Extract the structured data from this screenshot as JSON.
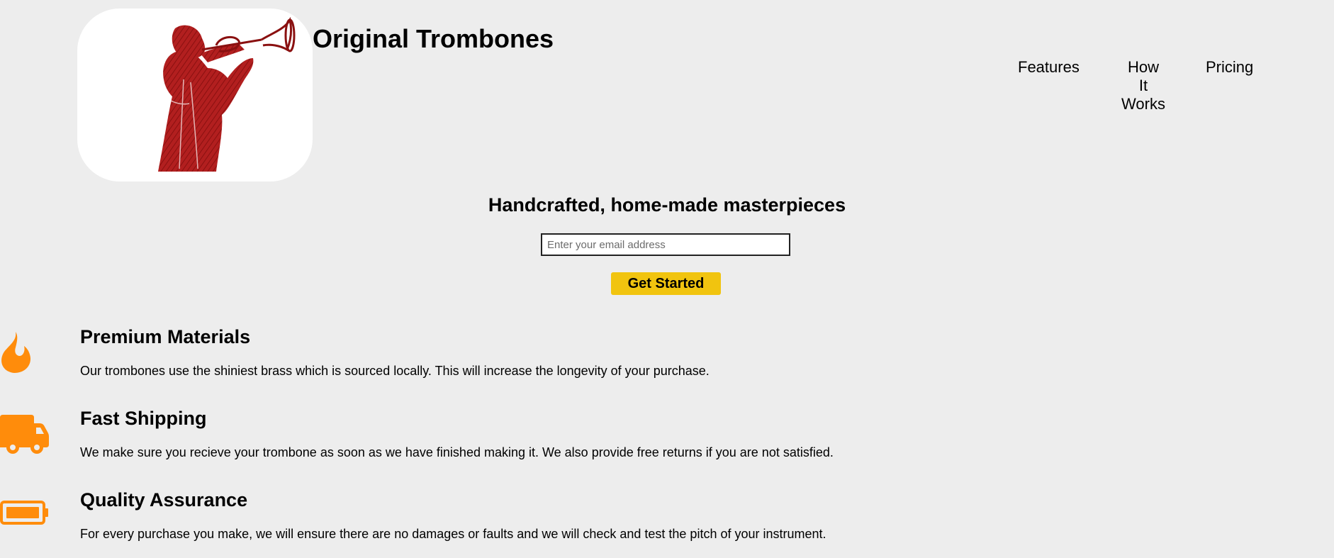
{
  "header": {
    "logo_icon": "trumpet-player-logo",
    "title": "Original Trombones"
  },
  "nav": {
    "features": "Features",
    "how_it_works": [
      "How",
      "It",
      "Works"
    ],
    "pricing": "Pricing"
  },
  "hero": {
    "title": "Handcrafted, home-made masterpieces",
    "email_placeholder": "Enter your email address",
    "email_value": "",
    "button_label": "Get Started"
  },
  "features": [
    {
      "icon": "fire-icon",
      "title": "Premium Materials",
      "description": "Our trombones use the shiniest brass which is sourced locally. This will increase the longevity of your purchase."
    },
    {
      "icon": "truck-icon",
      "title": "Fast Shipping",
      "description": "We make sure you recieve your trombone as soon as we have finished making it. We also provide free returns if you are not satisfied."
    },
    {
      "icon": "battery-icon",
      "title": "Quality Assurance",
      "description": "For every purchase you make, we will ensure there are no damages or faults and we will check and test the pitch of your instrument."
    }
  ],
  "colors": {
    "background": "#ededed",
    "accent_orange": "#ff8c0b",
    "button_yellow": "#f1c40f",
    "logo_red": "#b21f1f"
  }
}
